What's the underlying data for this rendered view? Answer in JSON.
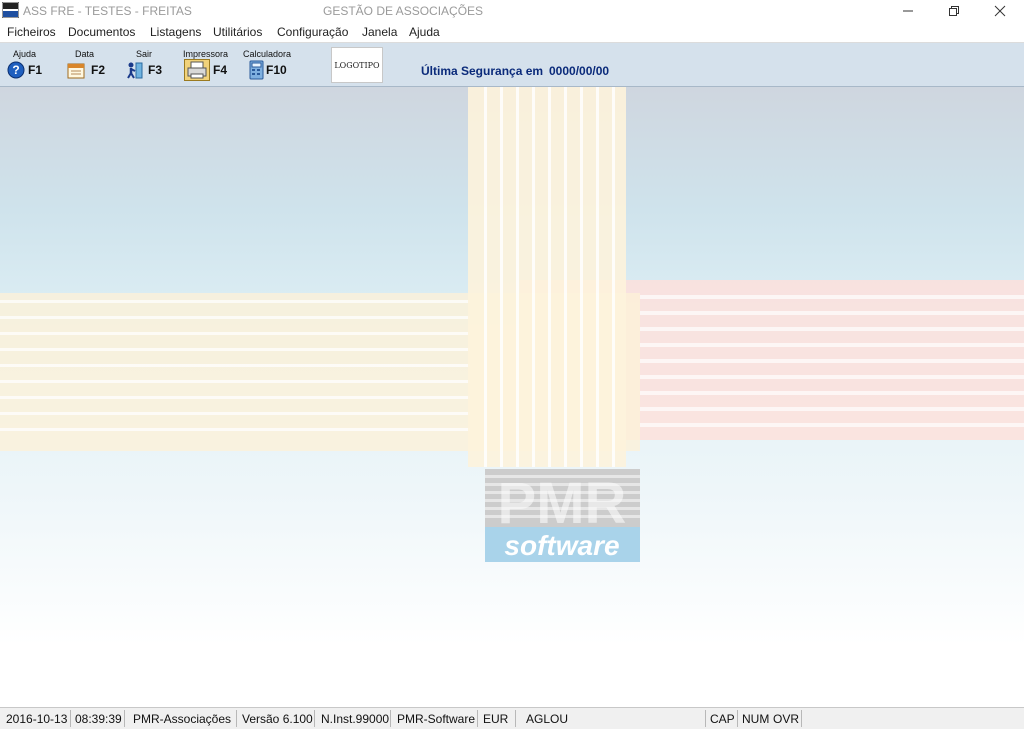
{
  "window": {
    "app_icon_label": "PMR",
    "title": "ASS FRE - TESTES - FREITAS",
    "center_title": "GESTÃO DE ASSOCIAÇÕES",
    "minimize_glyph": "—",
    "restore_glyph": "❐",
    "close_glyph": "✕"
  },
  "menu": {
    "items": [
      "Ficheiros",
      "Documentos",
      "Listagens",
      "Utilitários",
      "Configuração",
      "Janela",
      "Ajuda"
    ]
  },
  "toolbar": {
    "help": {
      "label": "Ajuda",
      "key": "F1",
      "icon": "help-icon"
    },
    "date": {
      "label": "Data",
      "key": "F2",
      "icon": "calendar-icon"
    },
    "exit": {
      "label": "Sair",
      "key": "F3",
      "icon": "exit-person-icon"
    },
    "printer": {
      "label": "Impressora",
      "key": "F4",
      "icon": "printer-icon"
    },
    "calculator": {
      "label": "Calculadora",
      "key": "F10",
      "icon": "calculator-icon"
    },
    "logo_text": "LOGOTIPO",
    "backup_label": "Última Segurança em",
    "backup_value": "0000/00/00"
  },
  "watermark": {
    "brand": "PMR",
    "text": "software"
  },
  "status": {
    "date": "2016-10-13",
    "time": "08:39:39",
    "app": "PMR-Associações",
    "version": "Versão  6.100",
    "inst": "N.Inst.99000",
    "vendor": "PMR-Software",
    "currency": "EUR",
    "user": "AGLOU",
    "cap": "CAP",
    "num": "NUM",
    "ovr": "OVR"
  },
  "colors": {
    "toolbar_bg": "#d5e1ec",
    "backup_text": "#0a2a7a",
    "watermark_blue": "#a9d3ea",
    "stripe_cream": "#fff3d6",
    "stripe_pink": "#ffd6d6"
  }
}
